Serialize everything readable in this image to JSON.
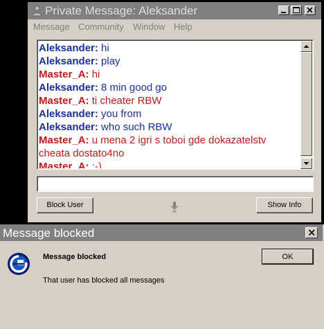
{
  "pm_window": {
    "title": "Private Message: Aleksander",
    "menu": [
      "Message",
      "Community",
      "Window",
      "Help"
    ],
    "messages": [
      {
        "sender": "Aleksander:",
        "text": " hi",
        "role": "a"
      },
      {
        "sender": "Aleksander:",
        "text": " play",
        "role": "a"
      },
      {
        "sender": "Master_A:",
        "text": " hi",
        "role": "m"
      },
      {
        "sender": "Aleksander:",
        "text": " 8 min good go",
        "role": "a"
      },
      {
        "sender": "Master_A:",
        "text": " ti cheater RBW",
        "role": "m"
      },
      {
        "sender": "Aleksander:",
        "text": " you from",
        "role": "a"
      },
      {
        "sender": "Aleksander:",
        "text": " who such RBW",
        "role": "a"
      },
      {
        "sender": "Master_A:",
        "text": " u mena 2 igri s toboi gde dokazatelstv cheata dostato4no",
        "role": "m"
      },
      {
        "sender": "Master_A:",
        "text": " :-)",
        "role": "m"
      }
    ],
    "input_value": "",
    "block_user_label": "Block User",
    "show_info_label": "Show Info",
    "colors": {
      "sender_a": "#1a2f9b",
      "sender_m": "#c11a1a"
    }
  },
  "dialog": {
    "title": "Message blocked",
    "heading": "Message blocked",
    "text": "That user has blocked all messages",
    "ok_label": "OK"
  },
  "icons": {
    "pm_title": "person-icon",
    "minimize": "minimize-icon",
    "maximize": "maximize-icon",
    "close": "close-icon",
    "mic": "microphone-icon",
    "dialog_logo": "app-logo-icon"
  }
}
